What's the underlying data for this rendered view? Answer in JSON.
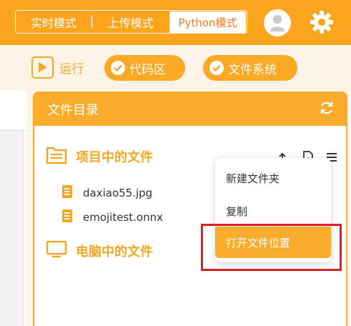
{
  "modes": [
    {
      "label": "实时模式",
      "active": false
    },
    {
      "label": "上传模式",
      "active": false
    },
    {
      "label": "Python模式",
      "active": true
    }
  ],
  "toolbar": {
    "run_label": "运行",
    "code_label": "代码区",
    "fs_label": "文件系统"
  },
  "icons": {
    "avatar": "user-avatar-icon",
    "settings": "gear-icon",
    "run": "play-icon",
    "refresh": "refresh-icon",
    "folder": "folder-icon",
    "file": "file-icon",
    "monitor": "monitor-icon",
    "upload": "upload-icon",
    "new_file": "new-file-icon",
    "menu": "menu-icon"
  },
  "file_panel": {
    "title": "文件目录",
    "project_section": "项目中的文件",
    "computer_section": "电脑中的文件",
    "files": [
      "daxiao55.jpg",
      "emojitest.onnx"
    ]
  },
  "context_menu": {
    "items": [
      "新建文件夹",
      "复制",
      "打开文件位置"
    ],
    "selected_index": 2
  },
  "colors": {
    "accent": "#f9ac2b",
    "topbar": "#fba41c",
    "highlight_outline": "#e21d24",
    "active_mode_text": "#f5781f"
  }
}
